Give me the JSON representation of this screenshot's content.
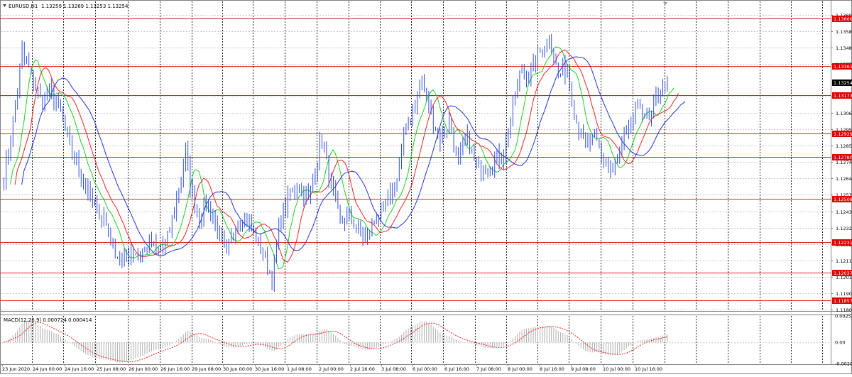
{
  "window": {
    "title": "EURUSD,H1",
    "ohlc": "1.13259 1.13269 1.13253 1.13254"
  },
  "macd": {
    "label": "MACD(12,26,9) 0.000724 0.000414"
  },
  "colors": {
    "candles": "#3050e0",
    "ma_fast": "#22cc22",
    "ma_mid": "#ee2222",
    "ma_slow": "#2233cc",
    "level_line": "#e02020",
    "level_tag": "#e00000",
    "current_tag": "#000000",
    "grid": "#c8c8c8",
    "separator": "#222222",
    "macd_hist": "#b0b0b0",
    "macd_signal": "#ee2222"
  },
  "chart_data": {
    "type": "candlestick",
    "symbol": "EURUSD",
    "timeframe": "H1",
    "ylim": [
      1.118,
      1.1372
    ],
    "price_axis_ticks": [
      "1.13690",
      "1.13585",
      "1.13480",
      "1.13375",
      "1.13165",
      "1.13060",
      "1.12955",
      "1.12850",
      "1.12745",
      "1.12640",
      "1.12535",
      "1.12430",
      "1.12325",
      "1.12220",
      "1.12115",
      "1.12010",
      "1.11905",
      "1.11800"
    ],
    "current_price": "1.13254",
    "horizontal_levels": [
      "1.13666",
      "1.13361",
      "1.13173",
      "1.12929",
      "1.12780",
      "1.12508",
      "1.12231",
      "1.12037",
      "1.11857"
    ],
    "time_axis_labels": [
      "23 Jun 2020",
      "24 Jun 00:00",
      "24 Jun 16:00",
      "25 Jun 08:00",
      "26 Jun 00:00",
      "26 Jun 16:00",
      "29 Jun 08:00",
      "30 Jun 00:00",
      "30 Jun 16:00",
      "1 Jul 08:00",
      "2 Jul 00:00",
      "2 Jul 16:00",
      "3 Jul 08:00",
      "6 Jul 00:00",
      "6 Jul 16:00",
      "7 Jul 08:00",
      "8 Jul 00:00",
      "8 Jul 16:00",
      "9 Jul 08:00",
      "10 Jul 00:00",
      "10 Jul 16:00"
    ],
    "close_path": [
      [
        0,
        1.1265
      ],
      [
        4,
        1.13
      ],
      [
        8,
        1.1345
      ],
      [
        12,
        1.133
      ],
      [
        16,
        1.1315
      ],
      [
        20,
        1.132
      ],
      [
        24,
        1.131
      ],
      [
        28,
        1.129
      ],
      [
        32,
        1.1275
      ],
      [
        36,
        1.126
      ],
      [
        40,
        1.1245
      ],
      [
        44,
        1.124
      ],
      [
        48,
        1.122
      ],
      [
        52,
        1.121
      ],
      [
        56,
        1.1218
      ],
      [
        60,
        1.1215
      ],
      [
        64,
        1.1222
      ],
      [
        68,
        1.1218
      ],
      [
        72,
        1.1225
      ],
      [
        76,
        1.125
      ],
      [
        80,
        1.128
      ],
      [
        82,
        1.126
      ],
      [
        86,
        1.124
      ],
      [
        90,
        1.1248
      ],
      [
        94,
        1.123
      ],
      [
        98,
        1.1215
      ],
      [
        102,
        1.1235
      ],
      [
        106,
        1.124
      ],
      [
        110,
        1.123
      ],
      [
        114,
        1.1215
      ],
      [
        118,
        1.12
      ],
      [
        122,
        1.124
      ],
      [
        126,
        1.1255
      ],
      [
        130,
        1.126
      ],
      [
        134,
        1.125
      ],
      [
        138,
        1.1278
      ],
      [
        140,
        1.129
      ],
      [
        144,
        1.126
      ],
      [
        148,
        1.1235
      ],
      [
        152,
        1.124
      ],
      [
        156,
        1.123
      ],
      [
        160,
        1.1225
      ],
      [
        164,
        1.124
      ],
      [
        168,
        1.1245
      ],
      [
        172,
        1.126
      ],
      [
        176,
        1.129
      ],
      [
        180,
        1.131
      ],
      [
        184,
        1.1325
      ],
      [
        188,
        1.1305
      ],
      [
        192,
        1.129
      ],
      [
        196,
        1.13
      ],
      [
        200,
        1.1275
      ],
      [
        204,
        1.129
      ],
      [
        208,
        1.127
      ],
      [
        212,
        1.1272
      ],
      [
        216,
        1.1275
      ],
      [
        220,
        1.128
      ],
      [
        224,
        1.131
      ],
      [
        228,
        1.1335
      ],
      [
        232,
        1.133
      ],
      [
        236,
        1.1345
      ],
      [
        240,
        1.1355
      ],
      [
        244,
        1.133
      ],
      [
        248,
        1.1335
      ],
      [
        252,
        1.13
      ],
      [
        256,
        1.1285
      ],
      [
        260,
        1.129
      ],
      [
        264,
        1.1275
      ],
      [
        268,
        1.1268
      ],
      [
        272,
        1.1285
      ],
      [
        276,
        1.1298
      ],
      [
        280,
        1.131
      ],
      [
        284,
        1.13
      ],
      [
        288,
        1.132
      ],
      [
        292,
        1.1325
      ]
    ],
    "macd_axis_ticks": [
      "0.002534",
      "0.00",
      "-0.00203"
    ],
    "macd_range": [
      -0.00203,
      0.002534
    ]
  }
}
